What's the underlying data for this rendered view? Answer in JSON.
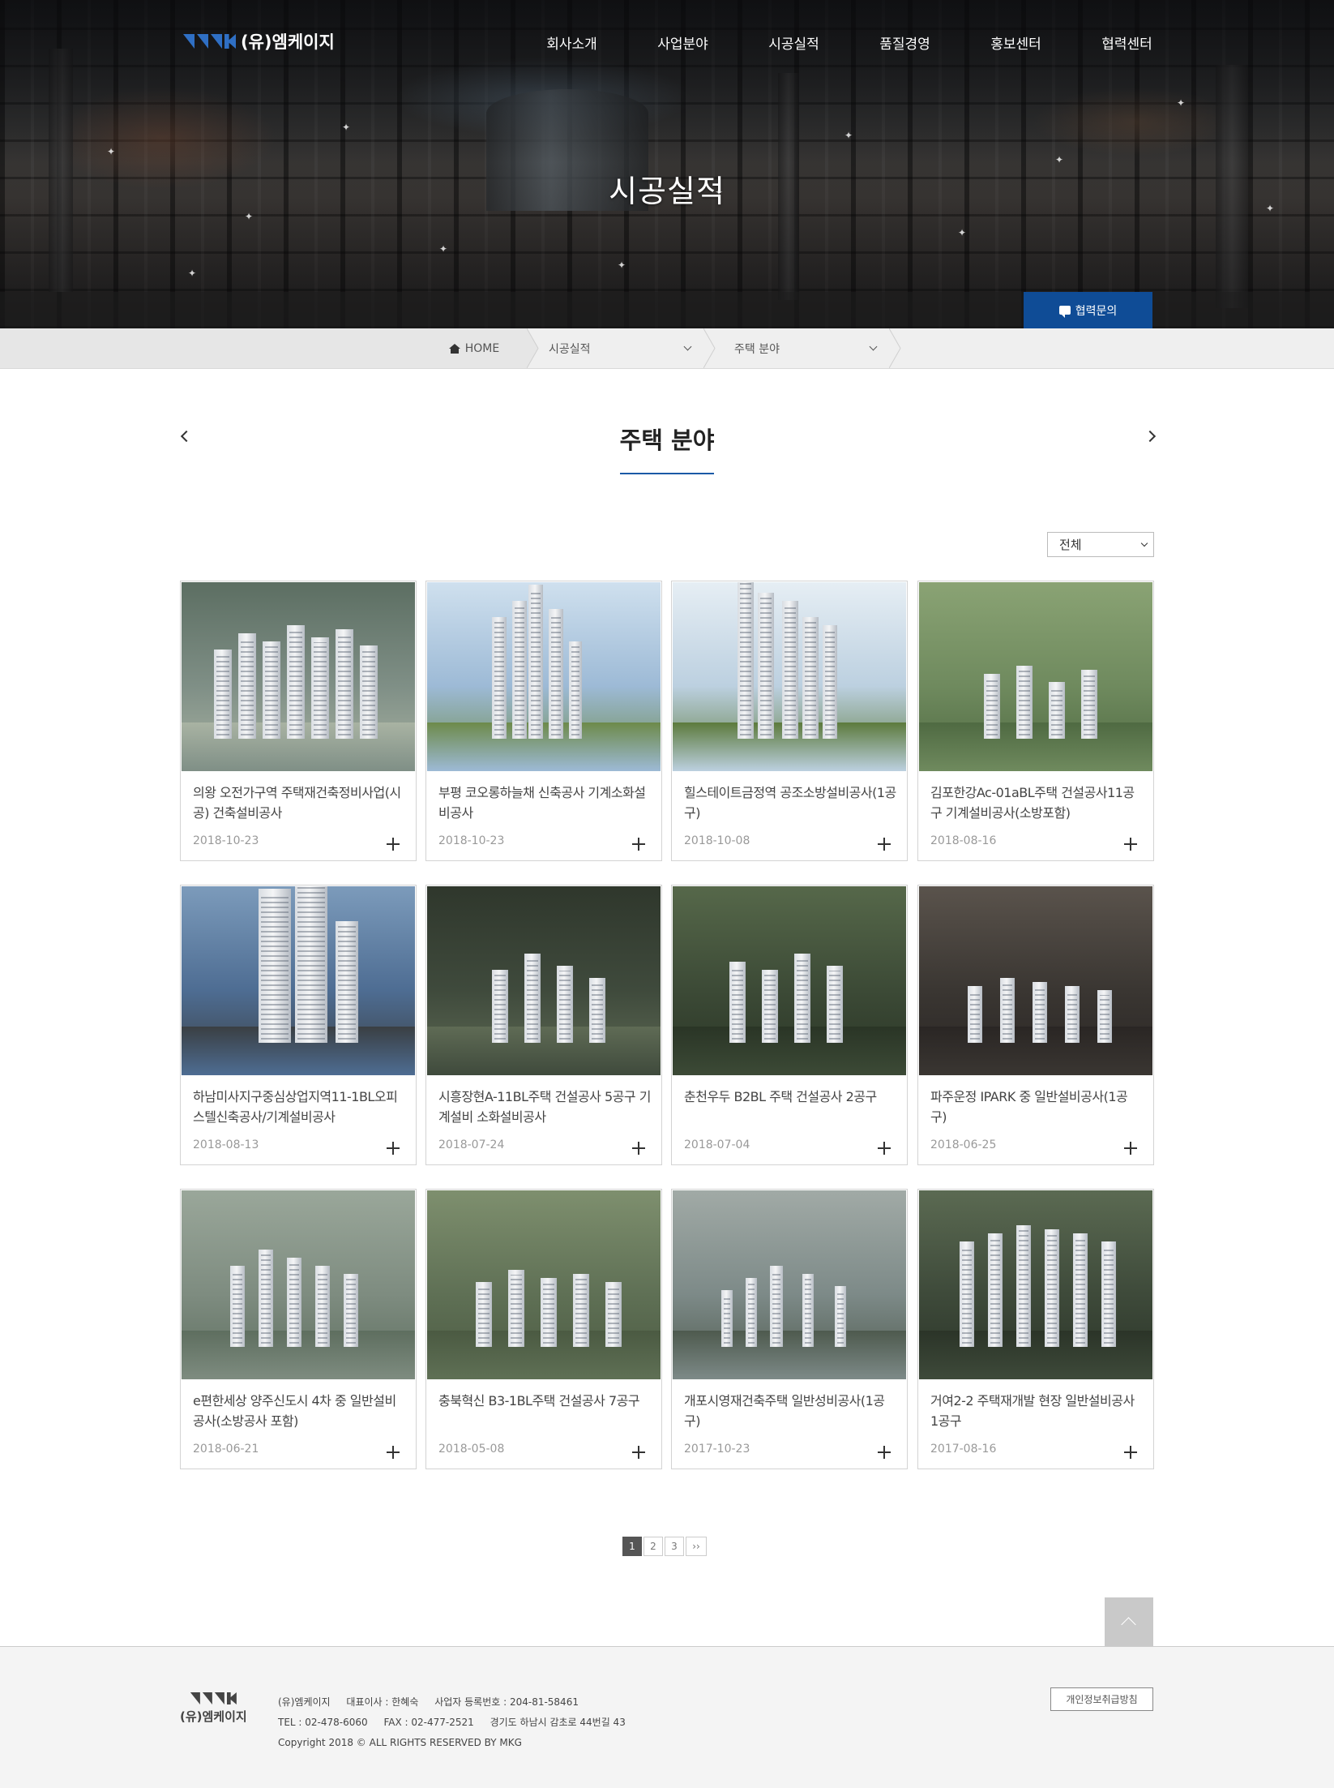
{
  "header": {
    "logo_text": "(유)엠케이지",
    "nav": [
      "회사소개",
      "사업분야",
      "시공실적",
      "품질경영",
      "홍보센터",
      "협력센터"
    ]
  },
  "hero": {
    "title": "시공실적",
    "contact_button": "협력문의"
  },
  "breadcrumb": {
    "home": "HOME",
    "level1": "시공실적",
    "level2": "주택 분야"
  },
  "section": {
    "title": "주택 분야",
    "filter_selected": "전체"
  },
  "projects": [
    {
      "title": "의왕 오전가구역 주택재건축정비사업(시공) 건축설비공사",
      "date": "2018-10-23"
    },
    {
      "title": "부평 코오롱하늘채 신축공사 기계소화설비공사",
      "date": "2018-10-23"
    },
    {
      "title": "힐스테이트금정역 공조소방설비공사(1공구)",
      "date": "2018-10-08"
    },
    {
      "title": "김포한강Ac-01aBL주택 건설공사11공구 기계설비공사(소방포함)",
      "date": "2018-08-16"
    },
    {
      "title": "하남미사지구중심상업지역11-1BL오피스텔신축공사/기계설비공사",
      "date": "2018-08-13"
    },
    {
      "title": "시흥장현A-11BL주택 건설공사 5공구 기계설비 소화설비공사",
      "date": "2018-07-24"
    },
    {
      "title": "춘천우두 B2BL 주택 건설공사 2공구",
      "date": "2018-07-04"
    },
    {
      "title": "파주운정 IPARK 중 일반설비공사(1공구)",
      "date": "2018-06-25"
    },
    {
      "title": "e편한세상 양주신도시 4차 중 일반설비공사(소방공사 포함)",
      "date": "2018-06-21"
    },
    {
      "title": "충북혁신 B3-1BL주택 건설공사 7공구",
      "date": "2018-05-08"
    },
    {
      "title": "개포시영재건축주택 일반성비공사(1공구)",
      "date": "2017-10-23"
    },
    {
      "title": "거여2-2 주택재개발 현장 일반설비공사 1공구",
      "date": "2017-08-16"
    }
  ],
  "pagination": {
    "pages": [
      "1",
      "2",
      "3"
    ],
    "next": "››"
  },
  "footer": {
    "company": "(유)엠케이지",
    "ceo": "대표이사 : 한혜숙",
    "biz_no": "사업자 등록번호 : 204-81-58461",
    "tel": "TEL : 02-478-6060",
    "fax": "FAX : 02-477-2521",
    "address": "경기도 하남시 감초로 44번길 43",
    "copyright": "Copyright 2018 © ALL RIGHTS RESERVED BY MKG",
    "privacy_button": "개인정보취급방침"
  },
  "colors": {
    "accent": "#0f4c96",
    "underline": "#1b5aa6",
    "logo_blue": "#2f6fc4"
  }
}
